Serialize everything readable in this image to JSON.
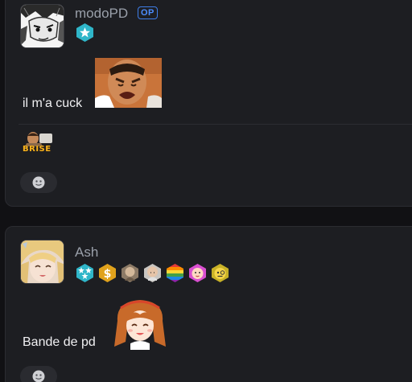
{
  "posts": [
    {
      "username": "modoPD",
      "op_label": "OP",
      "badges": [
        "star-hexagon-badge"
      ],
      "message": "il m'a cuck",
      "sticker": "crying-man-sticker",
      "reaction_sticker": "brise-sticker",
      "reaction_sticker_text": "BRISE",
      "react_icon": "add-reaction-icon"
    },
    {
      "username": "Ash",
      "badges": [
        "double-star-hexagon-badge",
        "dollar-coin-badge",
        "old-man-badge",
        "bald-man-badge",
        "rainbow-hexagon-badge",
        "baby-face-badge",
        "monocle-face-badge"
      ],
      "message": "Bande de pd",
      "sticker": "anime-girl-sticker",
      "react_icon": "add-reaction-icon"
    }
  ],
  "colors": {
    "background": "#111114",
    "card": "#1d1e22",
    "op_badge": "#3f7ee8",
    "username": "#9aa0aa",
    "badge_teal": "#2fb6c9"
  }
}
